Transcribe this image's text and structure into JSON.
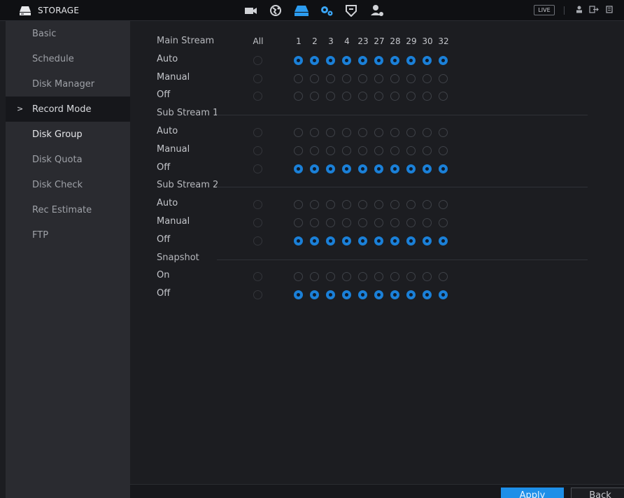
{
  "header": {
    "title": "STORAGE",
    "live_label": "LIVE",
    "icons": [
      "storage-icon",
      "camera-icon",
      "network-icon",
      "storage-nav-icon",
      "system-gear-icon",
      "security-shield-icon",
      "account-icon"
    ]
  },
  "sidebar": {
    "items": [
      {
        "label": "Basic"
      },
      {
        "label": "Schedule"
      },
      {
        "label": "Disk Manager"
      },
      {
        "label": "Record Mode"
      },
      {
        "label": "Disk Group"
      },
      {
        "label": "Disk Quota"
      },
      {
        "label": "Disk Check"
      },
      {
        "label": "Rec Estimate"
      },
      {
        "label": "FTP"
      }
    ]
  },
  "record_mode": {
    "all_label": "All",
    "channels": [
      "1",
      "2",
      "3",
      "4",
      "23",
      "27",
      "28",
      "29",
      "30",
      "32"
    ],
    "sections": [
      {
        "title": "Main Stream",
        "options": [
          "Auto",
          "Manual",
          "Off"
        ],
        "selected": "Auto"
      },
      {
        "title": "Sub Stream 1",
        "options": [
          "Auto",
          "Manual",
          "Off"
        ],
        "selected": "Off"
      },
      {
        "title": "Sub Stream 2",
        "options": [
          "Auto",
          "Manual",
          "Off"
        ],
        "selected": "Off"
      },
      {
        "title": "Snapshot",
        "options": [
          "On",
          "Off"
        ],
        "selected": "Off"
      }
    ]
  },
  "buttons": {
    "apply": "Apply",
    "back": "Back"
  },
  "colors": {
    "accent": "#1e8fe8",
    "radio_checked": "#1b80d8",
    "sidebar_bg": "#2a2b30",
    "main_bg": "#1c1d21"
  }
}
